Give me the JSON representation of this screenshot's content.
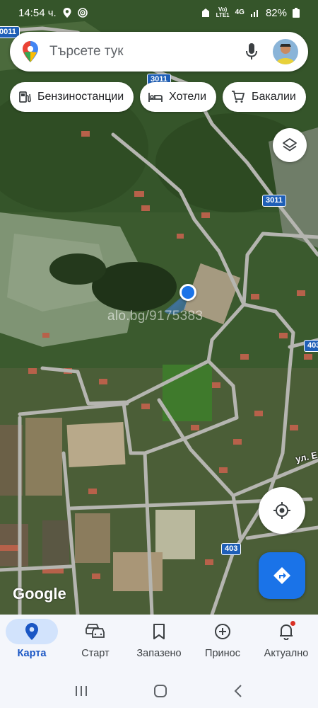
{
  "status_bar": {
    "time": "14:54 ч.",
    "network_top": "Vo)",
    "network_bottom": "LTE1",
    "signal_gen": "4G",
    "battery": "82%"
  },
  "search": {
    "placeholder": "Търсете тук",
    "mic_icon": "mic-icon",
    "maps_logo": "maps-pin-logo"
  },
  "chips": [
    {
      "label": "Бензиностанции",
      "icon": "gas-station-icon"
    },
    {
      "label": "Хотели",
      "icon": "bed-icon"
    },
    {
      "label": "Бакалии",
      "icon": "cart-icon"
    }
  ],
  "map": {
    "road_shields": [
      "3011",
      "3011",
      "3011",
      "403",
      "403"
    ],
    "partial_shield": "0011",
    "street_label": "ул. Е",
    "watermark": "alo.bg/9175383",
    "attribution": "Google"
  },
  "bottom_nav": [
    {
      "label": "Карта",
      "icon": "map-pin-icon",
      "active": true
    },
    {
      "label": "Старт",
      "icon": "car-icon",
      "active": false
    },
    {
      "label": "Запазено",
      "icon": "bookmark-icon",
      "active": false
    },
    {
      "label": "Принос",
      "icon": "add-circle-icon",
      "active": false
    },
    {
      "label": "Актуално",
      "icon": "bell-icon",
      "active": false
    }
  ],
  "colors": {
    "accent": "#1a73e8",
    "location_dot": "#1a73e8",
    "road_shield": "#1f5fb7"
  }
}
